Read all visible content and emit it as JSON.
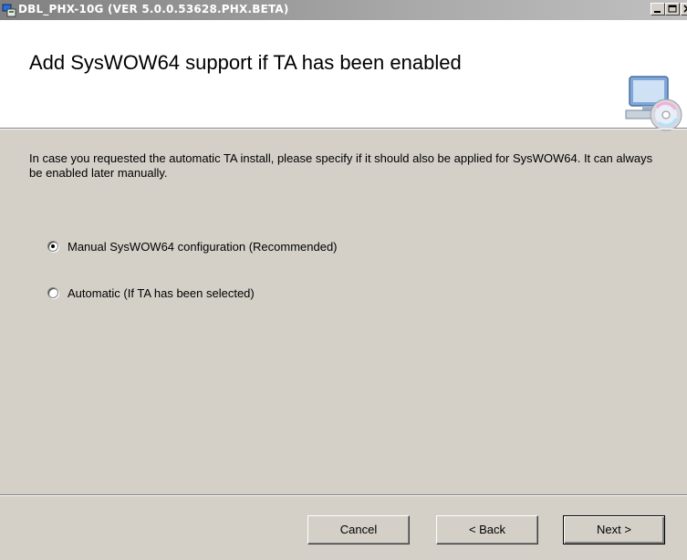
{
  "window": {
    "title": "DBL_PHX-10G (VER 5.0.0.53628.PHX.BETA)"
  },
  "banner": {
    "title": "Add SysWOW64 support if TA has been enabled",
    "icon": "computer-cd-icon"
  },
  "description": "In case you requested the automatic TA install, please specify if it should also be applied for SysWOW64. It can always be enabled later manually.",
  "options": [
    {
      "label": "Manual SysWOW64 configuration (Recommended)",
      "checked": true
    },
    {
      "label": "Automatic (If TA has been selected)",
      "checked": false
    }
  ],
  "buttons": {
    "cancel": "Cancel",
    "back": "< Back",
    "next": "Next >"
  }
}
